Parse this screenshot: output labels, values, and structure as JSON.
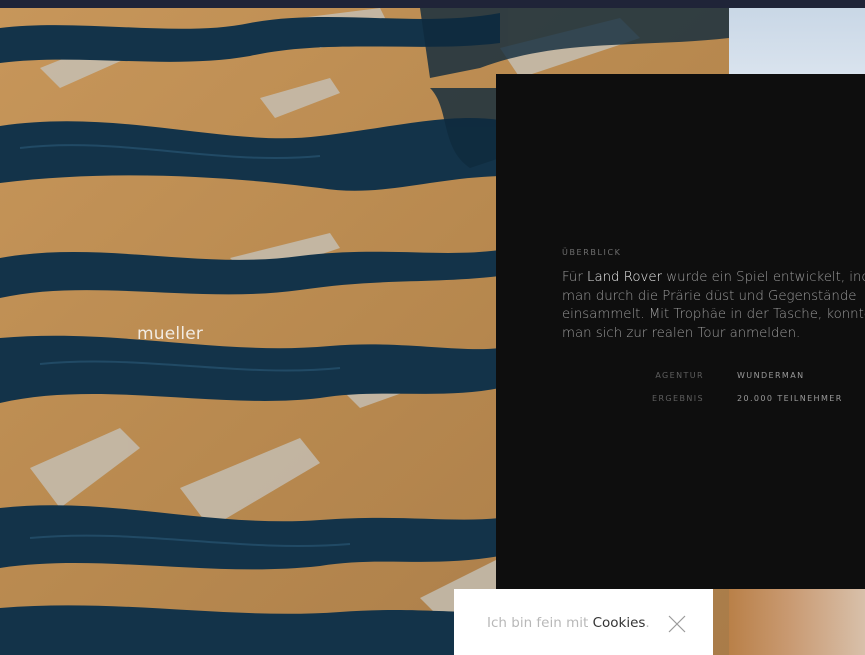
{
  "brand": {
    "name": "mueller"
  },
  "overview": {
    "label": "ÜBERBLICK",
    "line1_pre": "Für ",
    "line1_highlight": "Land Rover",
    "line1_post": " wurde ein Spiel entwickelt, ind",
    "line2": "man durch die Prärie düst und Gegenstände",
    "line3": "einsammelt. Mit Trophäe in der Tasche, konnte",
    "line4": "man sich zur realen Tour anmelden."
  },
  "meta": [
    {
      "label": "AGENTUR",
      "value": "WUNDERMAN"
    },
    {
      "label": "ERGEBNIS",
      "value": "20.000 TEILNEHMER"
    }
  ],
  "cookie": {
    "text_pre": "Ich bin fein mit ",
    "link": "Cookies",
    "text_post": ".",
    "close_icon": "close-icon"
  },
  "colors": {
    "topbar": "#1f2438",
    "panel": "#0e0e0e",
    "sand": "#b98a4e",
    "water": "#123247"
  }
}
